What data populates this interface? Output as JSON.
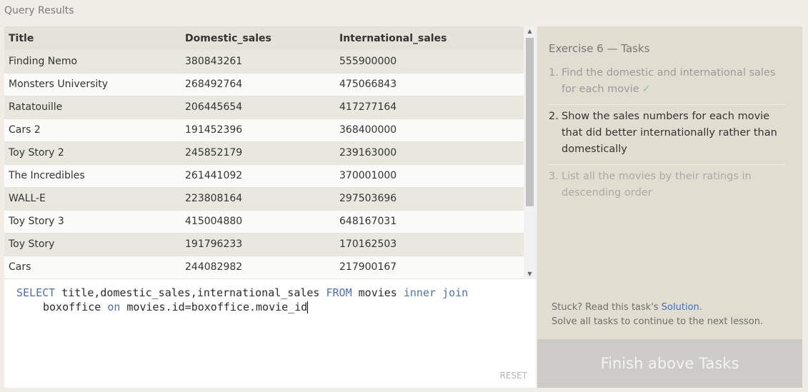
{
  "page": {
    "section_title": "Query Results"
  },
  "results": {
    "columns": [
      "Title",
      "Domestic_sales",
      "International_sales"
    ],
    "rows": [
      [
        "Finding Nemo",
        "380843261",
        "555900000"
      ],
      [
        "Monsters University",
        "268492764",
        "475066843"
      ],
      [
        "Ratatouille",
        "206445654",
        "417277164"
      ],
      [
        "Cars 2",
        "191452396",
        "368400000"
      ],
      [
        "Toy Story 2",
        "245852179",
        "239163000"
      ],
      [
        "The Incredibles",
        "261441092",
        "370001000"
      ],
      [
        "WALL-E",
        "223808164",
        "297503696"
      ],
      [
        "Toy Story 3",
        "415004880",
        "648167031"
      ],
      [
        "Toy Story",
        "191796233",
        "170162503"
      ],
      [
        "Cars",
        "244082982",
        "217900167"
      ]
    ]
  },
  "editor": {
    "line1": [
      {
        "text": "SELECT",
        "kw": true
      },
      {
        "text": " title,domestic_sales,international_sales ",
        "kw": false
      },
      {
        "text": "FROM",
        "kw": true
      },
      {
        "text": " movies ",
        "kw": false
      },
      {
        "text": "inner join",
        "kw": true
      }
    ],
    "line2": [
      {
        "text": "boxoffice ",
        "kw": false
      },
      {
        "text": "on",
        "kw": true
      },
      {
        "text": " movies.id=boxoffice.movie_id",
        "kw": false
      }
    ],
    "reset_label": "RESET",
    "keyword_color": "#4d6fb3"
  },
  "tasks": {
    "title": "Exercise 6 — Tasks",
    "items": [
      {
        "num": "1.",
        "text": "Find the domestic and international sales for each movie",
        "status": "done",
        "check": "✓"
      },
      {
        "num": "2.",
        "text": "Show the sales numbers for each movie that did better internationally rather than domestically",
        "status": "active"
      },
      {
        "num": "3.",
        "text": "List all the movies by their ratings in descending order",
        "status": "pending"
      }
    ],
    "help_prefix": "Stuck? Read this task's ",
    "help_link": "Solution",
    "help_suffix": ".",
    "help_line2": "Solve all tasks to continue to the next lesson.",
    "finish_label": "Finish above Tasks"
  },
  "colors": {
    "finish_bg": "#cccbc8",
    "link": "#3a6fc4",
    "check": "#8cc58c"
  }
}
